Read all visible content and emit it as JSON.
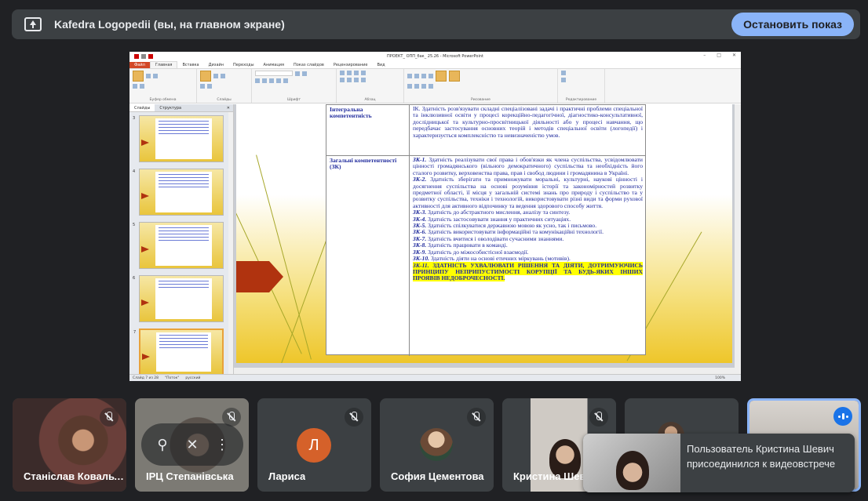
{
  "banner": {
    "title": "Kafedra Logopedii (вы, на главном экране)",
    "stop_label": "Остановить показ"
  },
  "ppt": {
    "window_title": "ПРОЕКТ_ ОПП_бак_ 25.26 - Microsoft PowerPoint",
    "tabs": [
      "Файл",
      "Главная",
      "Вставка",
      "Дизайн",
      "Переходы",
      "Анимация",
      "Показ слайдов",
      "Рецензирование",
      "Вид"
    ],
    "ribbon_groups": [
      "Буфер обмена",
      "Слайды",
      "Шрифт",
      "Абзац",
      "Рисование",
      "Редактирование"
    ],
    "panel_tabs": [
      "Слайды",
      "Структура"
    ],
    "thumbnails": [
      3,
      4,
      5,
      6,
      7
    ],
    "status": {
      "slide": "Слайд 7 из 28",
      "theme": "\"Поток\"",
      "lang": "русский",
      "zoom": "100%"
    },
    "table": {
      "row1_label": "Інтегральна компетентність",
      "row1_text": "ІК. Здатність розв'язувати складні спеціалізовані задачі і практичні проблеми спеціальної та інклюзивної освіти у процесі корекційно-педагогічної, діагностико-консультативної, дослідницької та культурно-просвітницької діяльності або у процесі навчання, що передбачає застосування основних теорій і методів спеціальної освіти (логопедії) і характеризується комплексністю та невизначеністю умов.",
      "row2_label": "Загальні компетентності (ЗК)",
      "items": [
        {
          "code": "ЗК-1.",
          "text": " Здатність реалізувати свої права і обов'язки як члена суспільства, усвідомлювати цінності громадянського (вільного демократичного) суспільства та необхідність його сталого розвитку, верховенства права, прав і свобод людини і громадянина в Україні."
        },
        {
          "code": "ЗК-2.",
          "text": " Здатність зберігати та примножувати моральні, культурні, наукові цінності і досягнення суспільства на основі розуміння історії та закономірностей розвитку предметної області, її місця у загальній системі знань про природу і суспільство та у розвитку суспільства, техніки і технологій, використовувати різні види та форми рухової активності для активного відпочинку та ведення здорового способу життя."
        },
        {
          "code": "ЗК-3.",
          "text": " Здатність до абстрактного мислення, аналізу та синтезу."
        },
        {
          "code": "ЗК-4.",
          "text": " Здатність застосовувати знання у практичних ситуаціях."
        },
        {
          "code": "ЗК-5.",
          "text": " Здатність спілкуватися державною мовою як усно, так і письмово."
        },
        {
          "code": "ЗК-6.",
          "text": " Здатність використовувати інформаційні та комунікаційні технології."
        },
        {
          "code": "ЗК-7.",
          "text": " Здатність вчитися і оволодівати сучасними знаннями."
        },
        {
          "code": "ЗК-8.",
          "text": " Здатність працювати в команді."
        },
        {
          "code": "ЗК-9.",
          "text": " Здатність до міжособистісної взаємодії."
        },
        {
          "code": "ЗК-10.",
          "text": " Здатність діяти на основі етичних міркувань (мотивів)."
        }
      ],
      "item11_code": "ЗК-11.",
      "item11_text": " ЗДАТНІСТЬ УХВАЛЮВАТИ РІШЕННЯ ТА ДІЯТИ, ДОТРИМУЮЧИСЬ ПРИНЦИПУ НЕПРИПУСТИМОСТІ КОРУПЦІЇ ТА БУДЬ-ЯКИХ ІНШИХ ПРОЯВІВ НЕДОБРОЧЕСНОСТІ."
    }
  },
  "participants": [
    {
      "name": "Станіслав Ковальчук",
      "muted": true,
      "video": "man"
    },
    {
      "name": "ІРЦ Степанівська",
      "muted": true,
      "video": "woman"
    },
    {
      "name": "Лариса",
      "muted": true,
      "avatar_letter": "Л"
    },
    {
      "name": "София Цементова",
      "muted": true,
      "video": "avatar"
    },
    {
      "name": "Кристина Шевич",
      "muted": true,
      "video": "woman2"
    },
    {
      "name": "",
      "muted": false,
      "video": "group"
    },
    {
      "name": "",
      "speaking": true,
      "video": "self"
    }
  ],
  "toast": {
    "message": "Пользователь Кристина Шевич присоединился к видеовстрече"
  },
  "colors": {
    "background": "#202124",
    "tile": "#3c4043",
    "accent": "#8ab4f8",
    "avatar_orange": "#d5612a"
  }
}
